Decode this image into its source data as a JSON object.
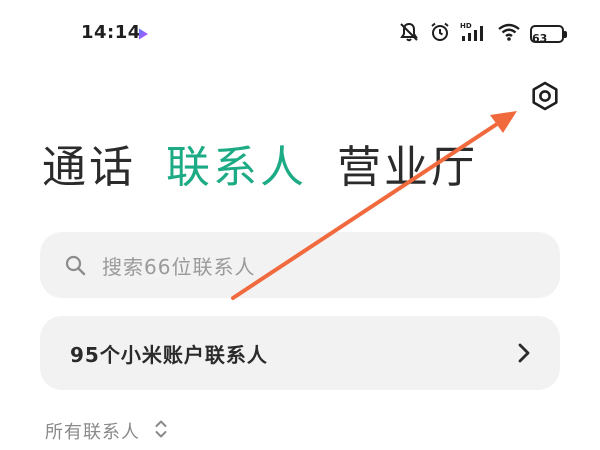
{
  "status_bar": {
    "time": "14:14",
    "battery_level": "63",
    "network_label": "HD"
  },
  "tabs": [
    {
      "label": "通话",
      "active": false
    },
    {
      "label": "联系人",
      "active": true
    },
    {
      "label": "营业厅",
      "active": false
    }
  ],
  "search": {
    "placeholder": "搜索66位联系人"
  },
  "mi_account": {
    "label": "95个小米账户联系人"
  },
  "filter": {
    "label": "所有联系人"
  },
  "colors": {
    "accent": "#1cab84",
    "annotation_arrow": "#f06a3e",
    "card_bg": "#f2f2f2"
  },
  "icons": {
    "settings": "hexagon-gear-icon",
    "search": "magnifier-icon",
    "chevron": "chevron-right-icon",
    "sort": "up-down-chevron-icon"
  }
}
